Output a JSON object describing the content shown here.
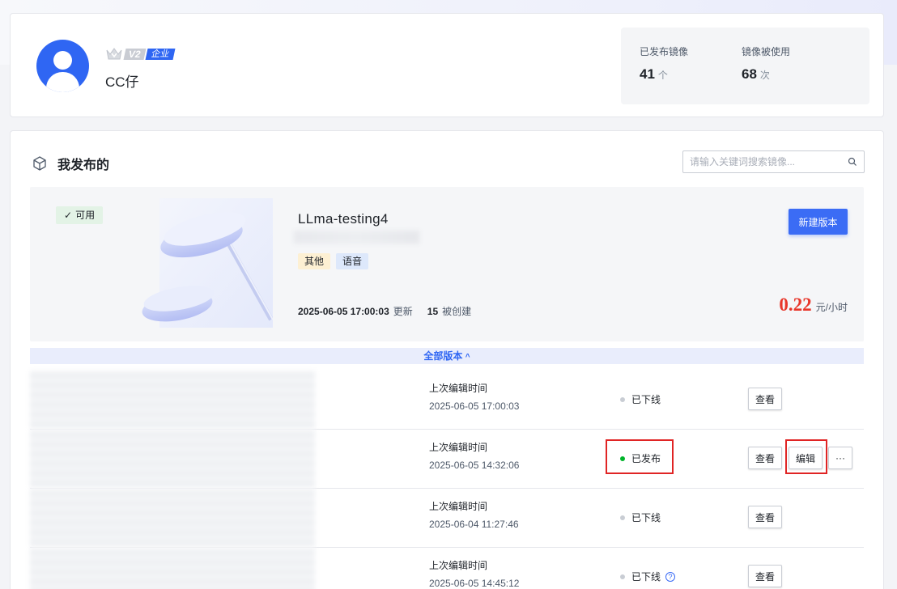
{
  "profile": {
    "level": "V2",
    "badge": "企业",
    "username": "CC仔",
    "stats": [
      {
        "label": "已发布镜像",
        "value": "41",
        "unit": "个"
      },
      {
        "label": "镜像被使用",
        "value": "68",
        "unit": "次"
      }
    ]
  },
  "section": {
    "title": "我发布的",
    "search_placeholder": "请输入关键词搜索镜像..."
  },
  "featured": {
    "status": "可用",
    "name": "LLma-testing4",
    "tags": [
      "其他",
      "语音"
    ],
    "updated_at": "2025-06-05 17:00:03",
    "updated_label": "更新",
    "created_count": "15",
    "created_label": "被创建",
    "new_version_label": "新建版本",
    "price": "0.22",
    "price_unit": "元/小时"
  },
  "all_versions_label": "全部版本",
  "versions": [
    {
      "edit_label": "上次编辑时间",
      "edit_time": "2025-06-05 17:00:03",
      "status": "已下线",
      "view_label": "查看"
    },
    {
      "edit_label": "上次编辑时间",
      "edit_time": "2025-06-05 14:32:06",
      "status": "已发布",
      "view_label": "查看",
      "edit_btn_label": "编辑",
      "more_label": "···"
    },
    {
      "edit_label": "上次编辑时间",
      "edit_time": "2025-06-04 11:27:46",
      "status": "已下线",
      "view_label": "查看"
    },
    {
      "edit_label": "上次编辑时间",
      "edit_time": "2025-06-05 14:45:12",
      "status": "已下线",
      "view_label": "查看",
      "help": "?"
    }
  ],
  "colors": {
    "accent": "#3b6cf5",
    "price": "#e8372b",
    "published": "#00b42a",
    "highlight": "#e02424"
  }
}
